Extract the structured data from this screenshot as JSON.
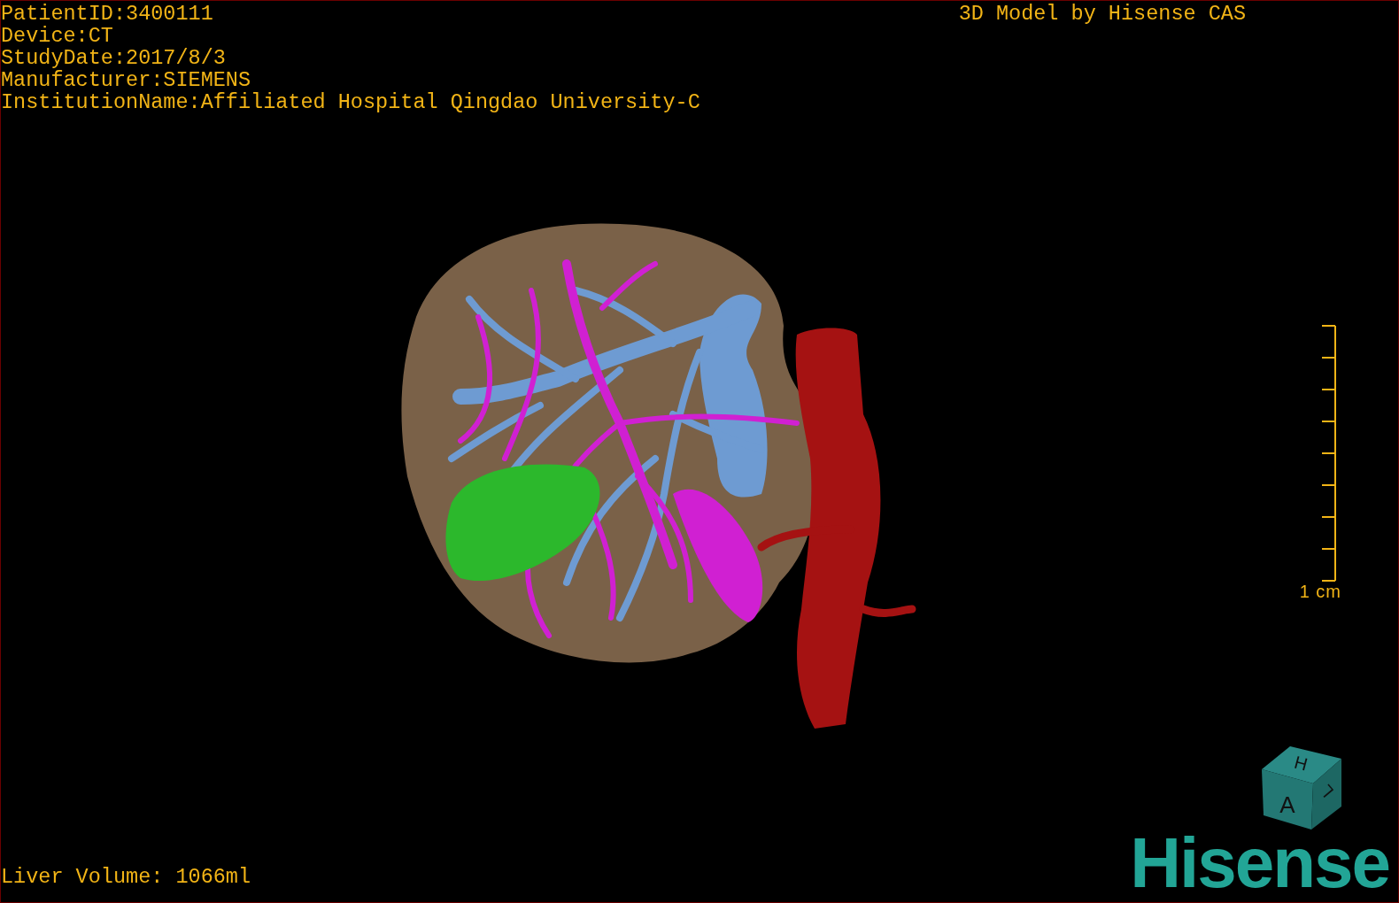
{
  "patient_info": [
    "PatientID:3400111",
    "Device:CT",
    "StudyDate:2017/8/3",
    "Manufacturer:SIEMENS",
    "InstitutionName:Affiliated Hospital Qingdao University-C"
  ],
  "title": "3D Model by Hisense CAS",
  "scale_bar": {
    "label": "1 cm"
  },
  "liver_volume": "Liver Volume: 1066ml",
  "orientation_cube": {
    "faces": [
      "H",
      "A",
      "L"
    ]
  },
  "logo": "Hisense"
}
